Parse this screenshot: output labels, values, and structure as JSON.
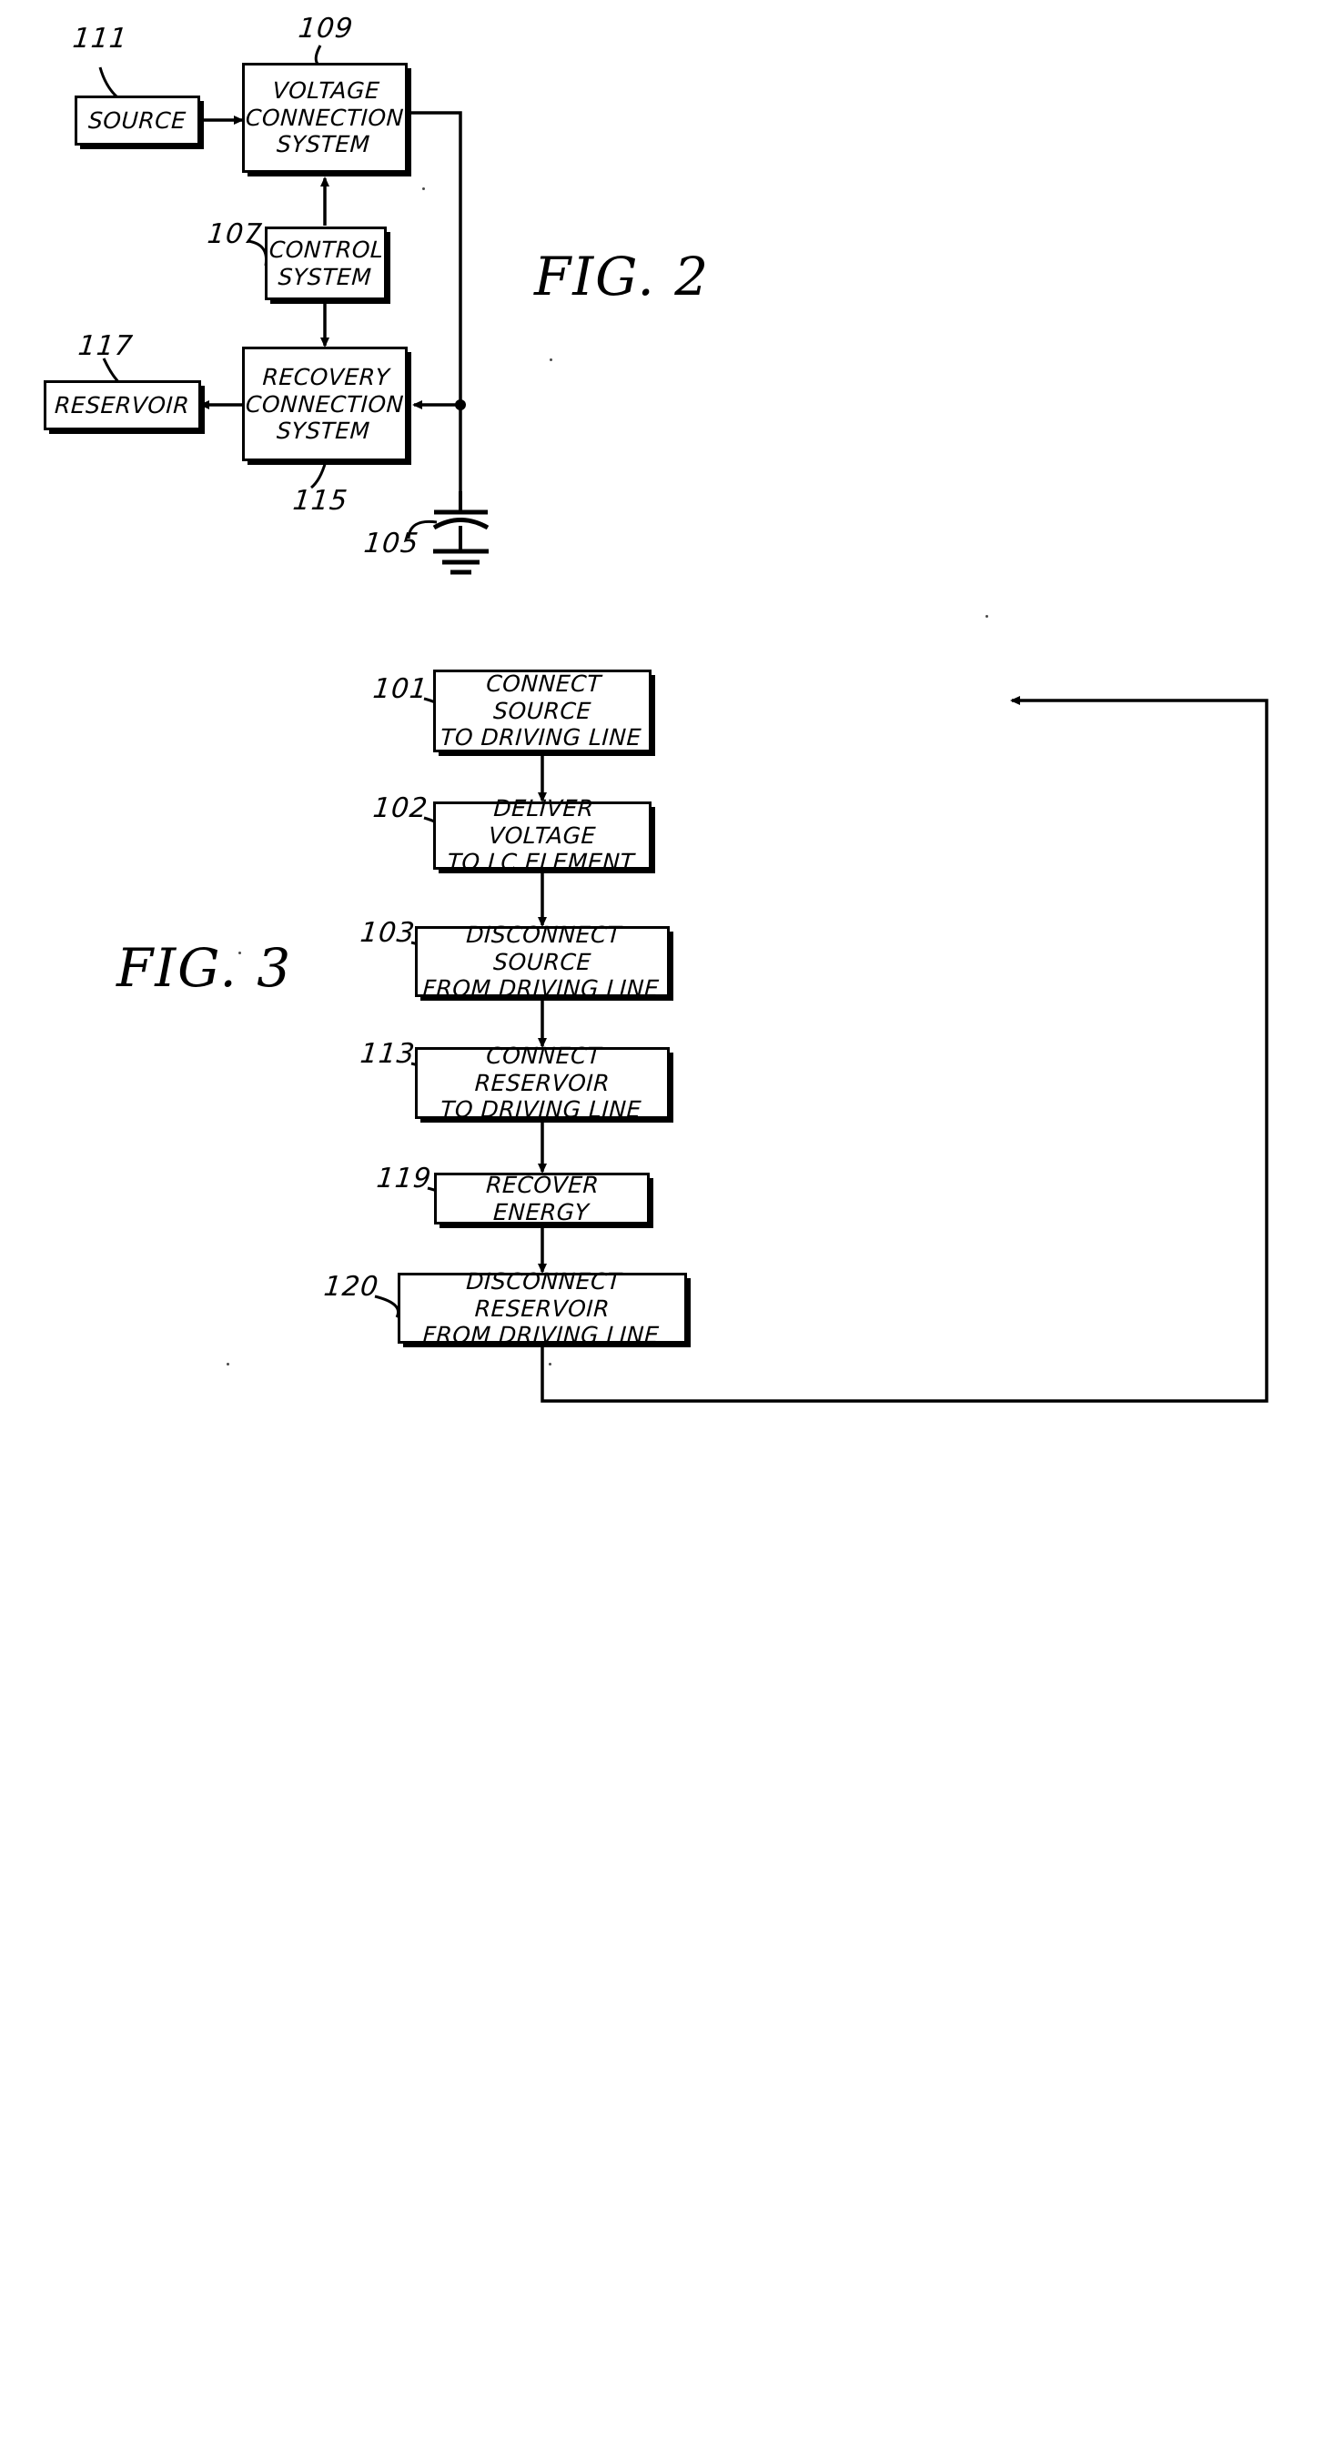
{
  "document": {
    "type": "patent-drawing-sheet",
    "figures": [
      "FIG. 2",
      "FIG. 3"
    ]
  },
  "fig2": {
    "title": "FIG.  2",
    "blocks": [
      {
        "id": "source",
        "ref": "111",
        "label": "SOURCE"
      },
      {
        "id": "voltage-connection",
        "ref": "109",
        "label": "VOLTAGE\nCONNECTION\nSYSTEM"
      },
      {
        "id": "control-system",
        "ref": "107",
        "label": "CONTROL\nSYSTEM"
      },
      {
        "id": "recovery-connection",
        "ref": "115",
        "label": "RECOVERY\nCONNECTION\nSYSTEM"
      },
      {
        "id": "reservoir",
        "ref": "117",
        "label": "RESERVOIR"
      }
    ],
    "capacitor": {
      "ref": "105",
      "symbol": "capacitor-to-ground"
    }
  },
  "fig3": {
    "title": "FIG.  3",
    "steps": [
      {
        "ref": "101",
        "label": "CONNECT  SOURCE\nTO  DRIVING  LINE"
      },
      {
        "ref": "102",
        "label": "DELIVER  VOLTAGE\nTO  LC  ELEMENT"
      },
      {
        "ref": "103",
        "label": "DISCONNECT  SOURCE\nFROM  DRIVING  LINE"
      },
      {
        "ref": "113",
        "label": "CONNECT  RESERVOIR\nTO  DRIVING  LINE"
      },
      {
        "ref": "119",
        "label": "RECOVER  ENERGY"
      },
      {
        "ref": "120",
        "label": "DISCONNECT  RESERVOIR\nFROM  DRIVING  LINE"
      }
    ],
    "loop": "feedback-from-step-120-to-step-101"
  }
}
